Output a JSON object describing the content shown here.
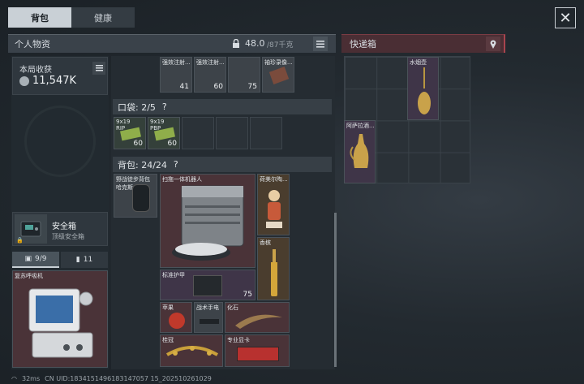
{
  "tabs": [
    {
      "label": "背包"
    },
    {
      "label": "健康"
    }
  ],
  "close_symbol": "✕",
  "personal": {
    "title": "个人物资",
    "weight": "48.0",
    "weight_unit": "/87千克",
    "earnings_label": "本局收获",
    "earnings_value": "11,547K"
  },
  "safebox": {
    "name": "安全箱",
    "type": "顶级安全箱"
  },
  "counters": {
    "a": "9/9",
    "b": "11"
  },
  "reviver": {
    "name": "复苏呼吸机"
  },
  "top_items": [
    {
      "name": "强效注射...",
      "qty": "41"
    },
    {
      "name": "强效注射...",
      "qty": "60"
    },
    {
      "qty": "75"
    },
    {
      "name": "袖珍录像..."
    }
  ],
  "pocket": {
    "title": "口袋: 2/5",
    "items": [
      {
        "name": "9x19\nRIP",
        "qty": "60"
      },
      {
        "name": "9x19\nPBP",
        "qty": "60"
      }
    ]
  },
  "backpack": {
    "title": "背包: 24/24",
    "pack": "野战徒步背包\n哈克斯",
    "robot": "扫拖一体机器人",
    "figurine": "荷美尔陶...",
    "perfume": "香槟",
    "armor": "标准护甲",
    "armor_qty": "75",
    "apple": "苹果",
    "flashlight": "战术手电",
    "fossil": "化石",
    "crown": "桂冠",
    "card": "专业显卡"
  },
  "delivery": {
    "title": "快递箱",
    "items": [
      {
        "name": "水烟壶"
      },
      {
        "name": "阿萨拉酒..."
      }
    ]
  },
  "status": {
    "ping": "32ms",
    "uid": "CN UID:1834151496183147057 15_202510261029"
  },
  "colors": {
    "accent_red": "#a8444e",
    "panel": "#3a424a"
  }
}
